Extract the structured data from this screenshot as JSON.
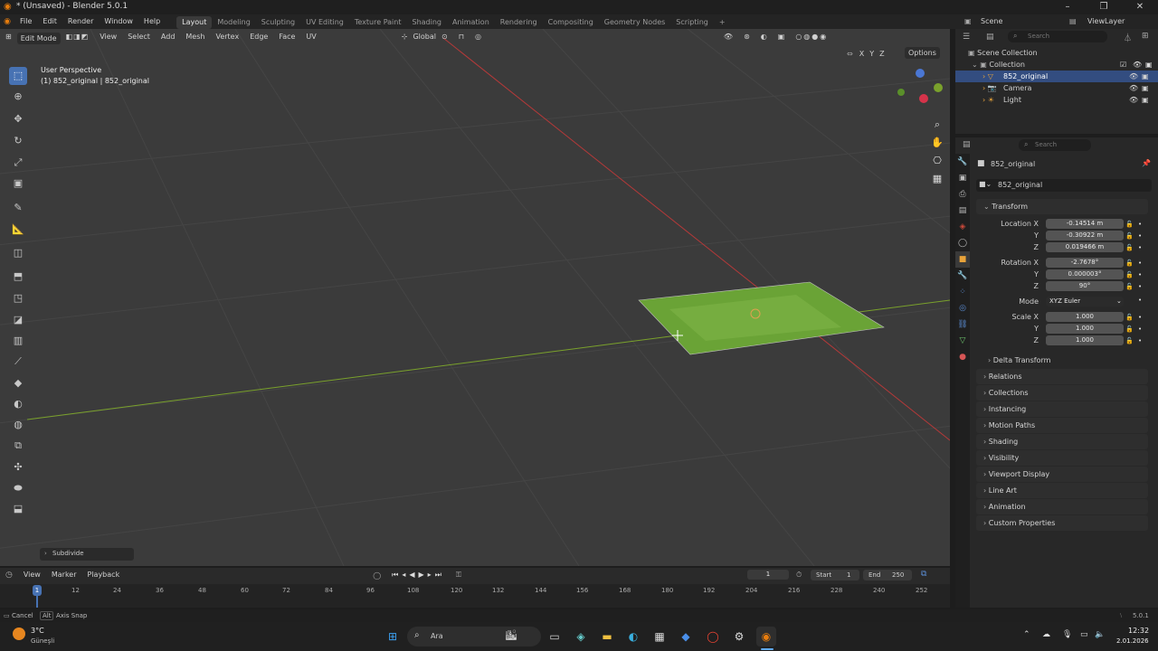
{
  "window": {
    "title": "* (Unsaved) - Blender 5.0.1"
  },
  "menu": {
    "items": [
      "File",
      "Edit",
      "Render",
      "Window",
      "Help"
    ],
    "workspaces": [
      "Layout",
      "Modeling",
      "Sculpting",
      "UV Editing",
      "Texture Paint",
      "Shading",
      "Animation",
      "Rendering",
      "Compositing",
      "Geometry Nodes",
      "Scripting"
    ],
    "add_workspace": "+"
  },
  "scene": {
    "scene_name": "Scene",
    "view_layer": "ViewLayer"
  },
  "viewport": {
    "mode": "Edit Mode",
    "menus": [
      "View",
      "Select",
      "Add",
      "Mesh",
      "Vertex",
      "Edge",
      "Face",
      "UV"
    ],
    "orientation": "Global",
    "options": "Options",
    "axes": [
      "X",
      "Y",
      "Z"
    ],
    "perspective": "User Perspective",
    "object_info": "(1) 852_original | 852_original",
    "operator_panel": "Subdivide"
  },
  "outliner": {
    "search_placeholder": "Search",
    "root": "Scene Collection",
    "collection": "Collection",
    "items": [
      {
        "name": "852_original",
        "selected": true
      },
      {
        "name": "Camera",
        "selected": false
      },
      {
        "name": "Light",
        "selected": false
      }
    ]
  },
  "properties": {
    "search_placeholder": "Search",
    "object_name": "852_original",
    "data_name": "852_original",
    "transform_title": "Transform",
    "location_label": "Location X",
    "location": [
      "-0.14514 m",
      "-0.30922 m",
      "0.019466 m"
    ],
    "rotation_label": "Rotation X",
    "rotation": [
      "-2.7678°",
      "0.000003°",
      "90°"
    ],
    "mode_label": "Mode",
    "mode_value": "XYZ Euler",
    "scale_label": "Scale X",
    "scale": [
      "1.000",
      "1.000",
      "1.000"
    ],
    "y_label": "Y",
    "z_label": "Z",
    "delta": "Delta Transform",
    "panels": [
      "Relations",
      "Collections",
      "Instancing",
      "Motion Paths",
      "Shading",
      "Visibility",
      "Viewport Display",
      "Line Art",
      "Animation",
      "Custom Properties"
    ]
  },
  "timeline": {
    "menus": [
      "View",
      "Marker",
      "Playback"
    ],
    "current_frame": "1",
    "start_label": "Start",
    "start": "1",
    "end_label": "End",
    "end": "250",
    "ticks": [
      "1",
      "12",
      "24",
      "36",
      "48",
      "60",
      "72",
      "84",
      "96",
      "108",
      "120",
      "132",
      "144",
      "156",
      "168",
      "180",
      "192",
      "204",
      "216",
      "228",
      "240",
      "252"
    ]
  },
  "status": {
    "cancel": "Cancel",
    "axis_key": "Alt",
    "axis_snap": "Axis Snap",
    "version": "5.0.1"
  },
  "taskbar": {
    "temp": "3°C",
    "weather": "Güneşli",
    "search": "Ara",
    "time": "12:32",
    "date": "2.01.2026"
  },
  "colors": {
    "accent": "#4772b3",
    "selected_row": "#334d80",
    "x_axis": "#b53939",
    "y_axis": "#7aa12c",
    "grass": "#6aa336"
  }
}
